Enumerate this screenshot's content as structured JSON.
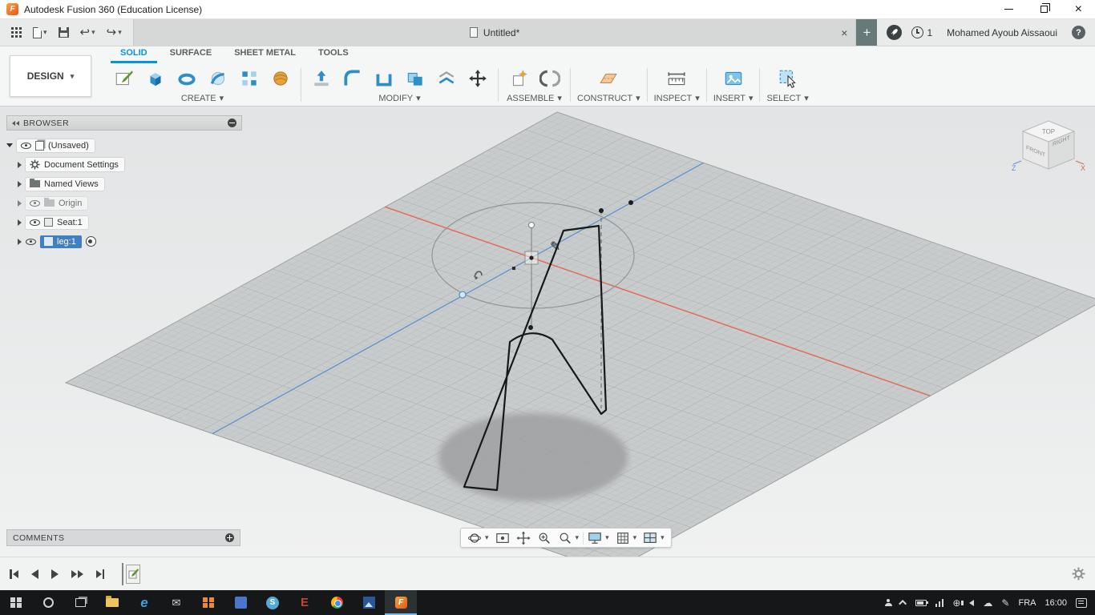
{
  "icons": {
    "chevron_down": "▾",
    "close": "×",
    "plus": "+",
    "undo": "↩",
    "redo": "↪",
    "pencil": "✎",
    "mail_glyph": "✉",
    "globe_glyph": "⊕",
    "cloud_glyph": "☁",
    "ink_glyph": "✎",
    "help": "?",
    "edge_letter": "e",
    "skype_letter": "S",
    "red_e_letter": "E"
  },
  "colors": {
    "accent_blue": "#0696d7",
    "selection_blue": "#3f7fc2",
    "axis_red": "#e8604c",
    "axis_blue": "#5e8fd0",
    "fusion_orange": "#f6882c"
  },
  "title_bar": {
    "app_title": "Autodesk Fusion 360 (Education License)"
  },
  "app_bar": {
    "tab_label": "Untitled*",
    "job_badge": "1",
    "user_name": "Mohamed Ayoub Aissaoui"
  },
  "workspace": {
    "label": "DESIGN"
  },
  "ribbon": {
    "active_tab": "SOLID",
    "tabs": [
      {
        "label": "SOLID"
      },
      {
        "label": "SURFACE"
      },
      {
        "label": "SHEET METAL"
      },
      {
        "label": "TOOLS"
      }
    ],
    "groups": [
      {
        "label": "CREATE"
      },
      {
        "label": "MODIFY"
      },
      {
        "label": "ASSEMBLE"
      },
      {
        "label": "CONSTRUCT"
      },
      {
        "label": "INSPECT"
      },
      {
        "label": "INSERT"
      },
      {
        "label": "SELECT"
      }
    ]
  },
  "browser": {
    "title": "BROWSER",
    "items": [
      {
        "label": "(Unsaved)"
      },
      {
        "label": "Document Settings"
      },
      {
        "label": "Named Views"
      },
      {
        "label": "Origin"
      },
      {
        "label": "Seat:1"
      },
      {
        "label": "leg:1"
      }
    ]
  },
  "comments": {
    "title": "COMMENTS"
  },
  "viewcube": {
    "top": "TOP",
    "front": "FRONT",
    "right": "RIGHT",
    "axis_z": "Z",
    "axis_x": "X"
  },
  "taskbar": {
    "language": "FRA",
    "time": "16:00"
  }
}
